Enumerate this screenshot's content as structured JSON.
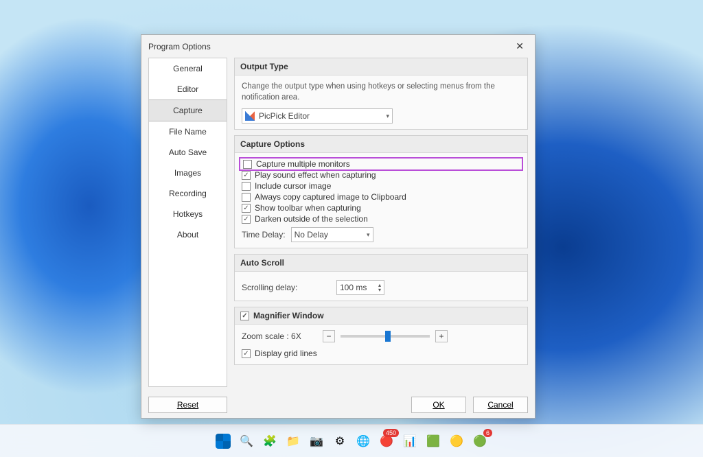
{
  "dialog": {
    "title": "Program Options",
    "nav": [
      "General",
      "Editor",
      "Capture",
      "File Name",
      "Auto Save",
      "Images",
      "Recording",
      "Hotkeys",
      "About"
    ],
    "nav_selected": "Capture",
    "output_type": {
      "header": "Output Type",
      "desc": "Change the output type when using hotkeys or selecting menus from the notification area.",
      "combo": "PicPick Editor"
    },
    "capture_options": {
      "header": "Capture Options",
      "items": [
        {
          "label": "Capture multiple monitors",
          "checked": false,
          "highlight": true
        },
        {
          "label": "Play sound effect when capturing",
          "checked": true
        },
        {
          "label": "Include cursor image",
          "checked": false
        },
        {
          "label": "Always copy captured image to Clipboard",
          "checked": false
        },
        {
          "label": "Show toolbar when capturing",
          "checked": true
        },
        {
          "label": "Darken outside of the selection",
          "checked": true
        }
      ],
      "time_delay_label": "Time Delay:",
      "time_delay_value": "No Delay"
    },
    "auto_scroll": {
      "header": "Auto Scroll",
      "label": "Scrolling delay:",
      "value": "100 ms"
    },
    "magnifier": {
      "header": "Magnifier Window",
      "header_checked": true,
      "zoom_label": "Zoom scale : 6X",
      "zoom_percent": 50,
      "grid_label": "Display grid lines",
      "grid_checked": true
    },
    "buttons": {
      "reset": "Reset",
      "ok": "OK",
      "cancel": "Cancel"
    }
  },
  "taskbar": {
    "icons": [
      {
        "name": "start-icon",
        "glyph": "",
        "color": ""
      },
      {
        "name": "search-icon",
        "glyph": "🔍",
        "color": "#333"
      },
      {
        "name": "sticker-icon",
        "glyph": "🧩",
        "color": "#7a5c00"
      },
      {
        "name": "file-explorer-icon",
        "glyph": "📁",
        "color": "#f5c542"
      },
      {
        "name": "camera-icon",
        "glyph": "📷",
        "color": "#2b6cb0"
      },
      {
        "name": "settings-icon",
        "glyph": "⚙",
        "color": "#555"
      },
      {
        "name": "edge-icon",
        "glyph": "🌐",
        "color": "#0ea5e9"
      },
      {
        "name": "app-red-icon",
        "glyph": "🔴",
        "color": "#e53935",
        "badge": "450"
      },
      {
        "name": "finance-icon",
        "glyph": "📊",
        "color": "#10b981"
      },
      {
        "name": "excel-icon",
        "glyph": "🟩",
        "color": "#107c41"
      },
      {
        "name": "chrome-icon",
        "glyph": "🟡",
        "color": "#fbbf24"
      },
      {
        "name": "whatsapp-icon",
        "glyph": "🟢",
        "color": "#25d366",
        "badge": "6"
      }
    ]
  }
}
